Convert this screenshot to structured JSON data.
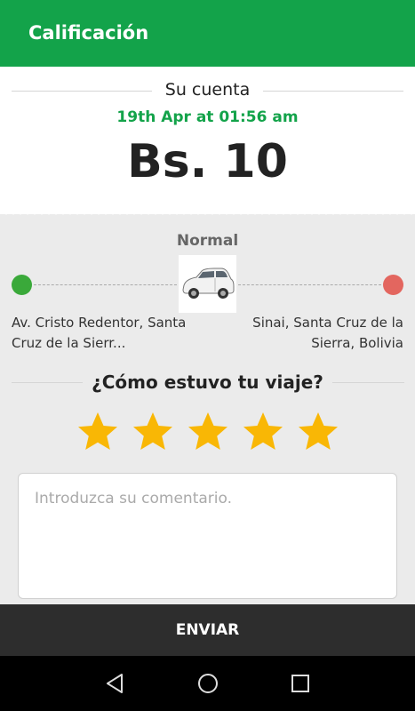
{
  "header": {
    "title": "Calificación"
  },
  "receipt": {
    "heading": "Su cuenta",
    "datetime": "19th Apr at 01:56 am",
    "amount": "Bs. 10"
  },
  "trip": {
    "ride_type": "Normal",
    "origin": "Av. Cristo Redentor, Santa Cruz de la Sierr...",
    "destination": "Sinai, Santa Cruz de la Sierra, Bolivia"
  },
  "rating": {
    "question": "¿Cómo estuvo tu viaje?",
    "stars": 5,
    "max_stars": 5
  },
  "comment": {
    "placeholder": "Introduzca su comentario."
  },
  "submit": {
    "label": "ENVIAR"
  },
  "colors": {
    "brand_green": "#13a34a",
    "star": "#f9b705",
    "origin_dot": "#3aa93a",
    "destination_dot": "#e3665f"
  },
  "icons": [
    "car-icon",
    "star-icon",
    "back-icon",
    "home-icon",
    "recents-icon"
  ]
}
